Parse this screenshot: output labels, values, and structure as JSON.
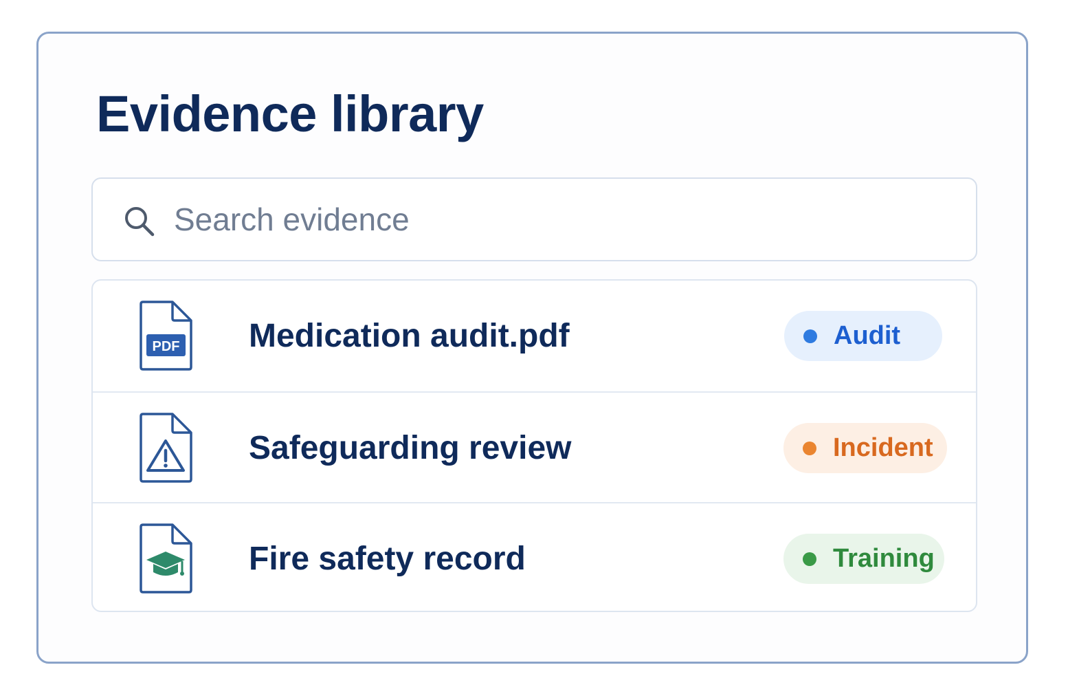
{
  "page": {
    "title": "Evidence library"
  },
  "search": {
    "placeholder": "Search evidence",
    "value": "",
    "icon": "search-icon"
  },
  "evidence": {
    "items": [
      {
        "name": "Medication audit.pdf",
        "icon": "pdf-file-icon",
        "icon_label": "PDF",
        "tag": "Audit",
        "tag_color": "#2f7be0"
      },
      {
        "name": "Safeguarding review",
        "icon": "warning-file-icon",
        "tag": "Incident",
        "tag_color": "#ea8530"
      },
      {
        "name": "Fire safety record",
        "icon": "graduation-cap-file-icon",
        "tag": "Training",
        "tag_color": "#3a9a47"
      }
    ]
  },
  "colors": {
    "heading": "#0f2a5a",
    "panel_border": "#8aa3c9",
    "icon_stroke": "#2c5797",
    "icon_accent_green": "#2e8a6a"
  }
}
